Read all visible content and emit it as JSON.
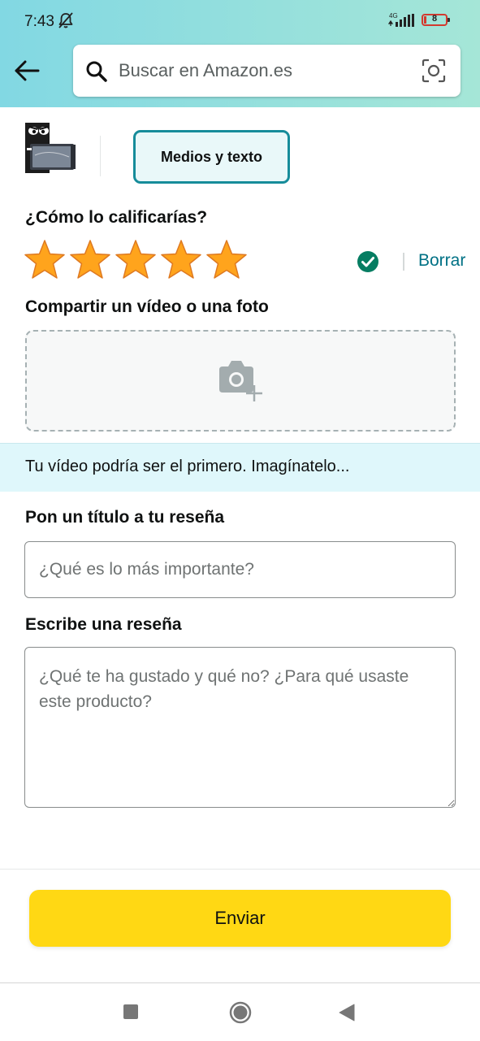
{
  "status_bar": {
    "time": "7:43",
    "network": "4G",
    "battery_level": "8",
    "icons": [
      "bell-off-icon",
      "signal-icon",
      "battery-icon"
    ]
  },
  "header": {
    "back_icon": "arrow-left-icon",
    "search": {
      "placeholder": "Buscar en Amazon.es",
      "value": "",
      "icon": "search-icon",
      "camera_icon": "camera-search-icon"
    }
  },
  "media_tab": {
    "label": "Medios y texto"
  },
  "rating": {
    "heading": "¿Cómo lo calificarías?",
    "stars_selected": 5,
    "stars_total": 5,
    "clear_label": "Borrar"
  },
  "media_upload": {
    "heading": "Compartir un vídeo o una foto",
    "icon": "add-photo-icon"
  },
  "info_banner": {
    "text": "Tu vídeo podría ser el primero. Imagínatelo..."
  },
  "review_title": {
    "heading": "Pon un título a tu reseña",
    "placeholder": "¿Qué es lo más importante?",
    "value": ""
  },
  "review_body": {
    "heading": "Escribe una reseña",
    "placeholder": "¿Qué te ha gustado y qué no? ¿Para qué usaste este producto?",
    "value": ""
  },
  "submit": {
    "label": "Enviar"
  },
  "colors": {
    "header_gradient_start": "#82d8e3",
    "header_gradient_end": "#a5e6d7",
    "accent_teal": "#168c9a",
    "link": "#007185",
    "star": "#ffa41c",
    "button": "#ffd814",
    "check": "#067d62",
    "info_band": "#dff7fb"
  }
}
